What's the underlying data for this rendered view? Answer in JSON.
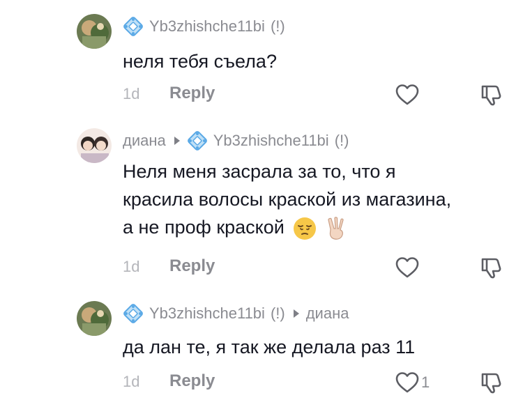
{
  "comments": [
    {
      "author": "Yb3zhishche11bi",
      "author_flag": "(!)",
      "text_lines": [
        "неля тебя съела?"
      ],
      "time": "1d",
      "reply_label": "Reply",
      "like_count": "",
      "avatar_icon": "avatar-photo-icon"
    },
    {
      "author": "диана",
      "reply_to": "Yb3zhishche11bi",
      "reply_to_flag": "(!)",
      "text_lines": [
        "Неля меня засрала за то, что я",
        "красила волосы краской из магазина,",
        "а не проф краской"
      ],
      "emojis": [
        "pensive-face-icon",
        "victory-hand-icon"
      ],
      "time": "1d",
      "reply_label": "Reply",
      "like_count": "",
      "avatar_icon": "avatar-photo-icon"
    },
    {
      "author": "Yb3zhishche11bi",
      "author_flag": "(!)",
      "reply_to": "диана",
      "text_lines": [
        "да лан те, я так же делала раз 11"
      ],
      "time": "1d",
      "reply_label": "Reply",
      "like_count": "1",
      "avatar_icon": "avatar-photo-icon"
    }
  ],
  "icons": {
    "like": "heart-outline-icon",
    "dislike": "thumbs-down-outline-icon",
    "reply_arrow": "reply-arrow-icon",
    "badge": "diamond-badge-icon"
  },
  "colors": {
    "text": "#161823",
    "secondary": "#8a8b91",
    "muted": "#b4b5ba",
    "badge_blue": "#5aa9e6"
  }
}
